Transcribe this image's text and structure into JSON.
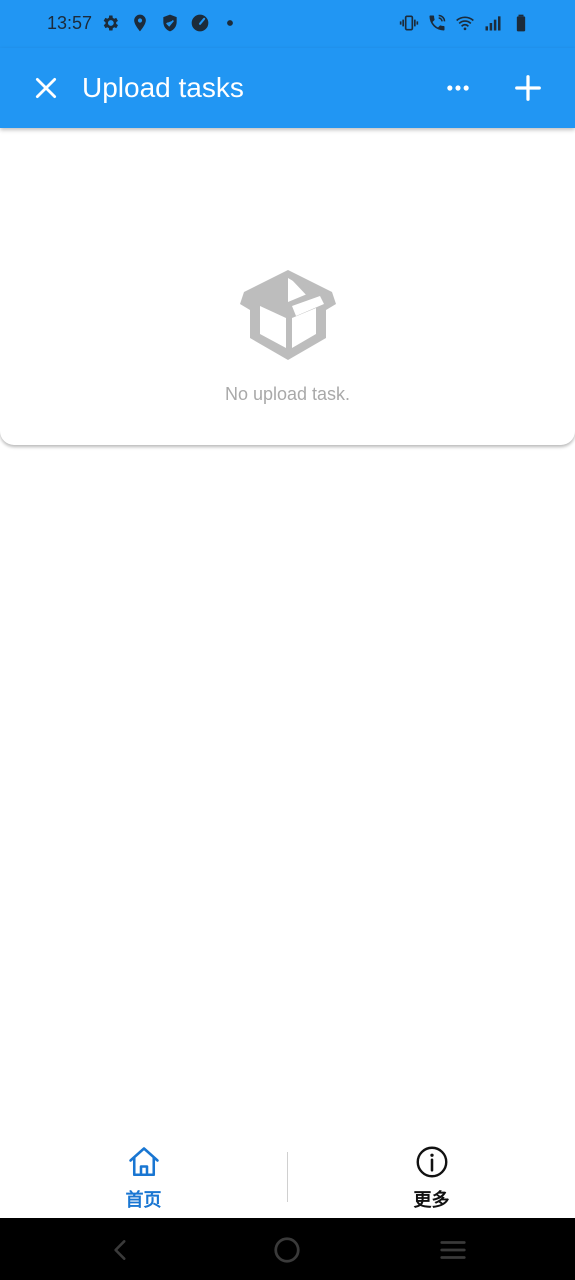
{
  "status_bar": {
    "time": "13:57",
    "left_icons": [
      "settings-icon",
      "location-icon",
      "shield-icon",
      "speedometer-icon",
      "dot-icon"
    ],
    "right_icons": [
      "vibrate-icon",
      "wifi-calling-icon",
      "wifi-icon",
      "signal-icon",
      "battery-icon"
    ]
  },
  "app_bar": {
    "title": "Upload tasks",
    "close_icon": "close-icon",
    "more_icon": "more-horizontal-icon",
    "add_icon": "add-icon",
    "background_color": "#2196f3"
  },
  "empty_state": {
    "icon": "open-box-icon",
    "message": "No upload task."
  },
  "bottom_nav": {
    "items": [
      {
        "label": "首页",
        "icon": "home-icon",
        "active": true,
        "color": "#1976d2"
      },
      {
        "label": "更多",
        "icon": "info-icon",
        "active": false,
        "color": "#111111"
      }
    ]
  },
  "system_nav": {
    "buttons": [
      "back-icon",
      "home-circle-icon",
      "recents-icon"
    ]
  }
}
